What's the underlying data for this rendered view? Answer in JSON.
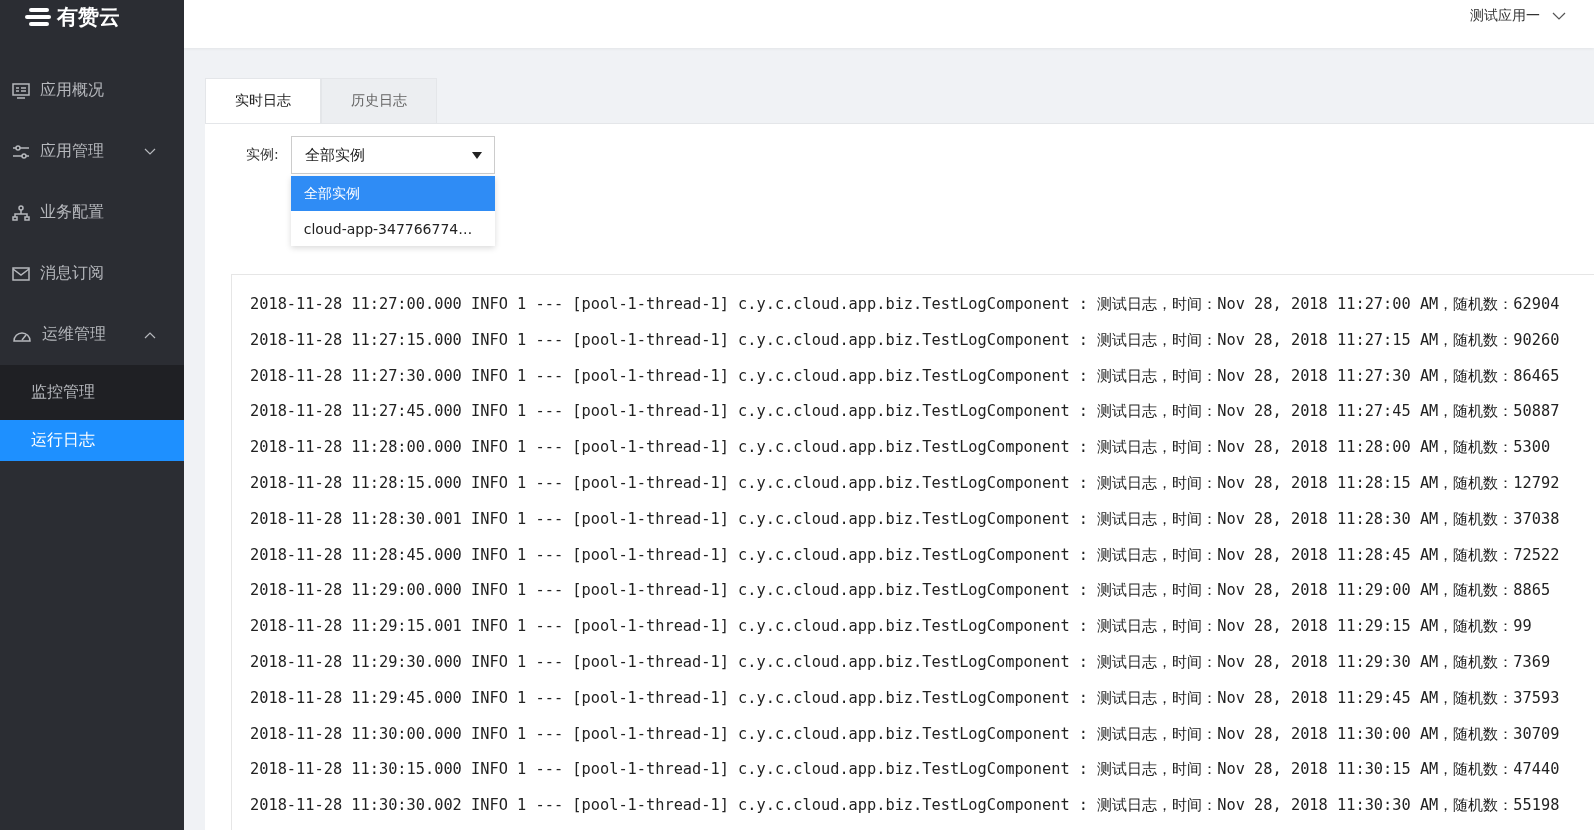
{
  "logo": {
    "text": "有赞云"
  },
  "sidebar": {
    "items": [
      {
        "label": "应用概况",
        "selected": false
      },
      {
        "label": "应用管理",
        "selected": false,
        "expanded": false
      },
      {
        "label": "业务配置",
        "selected": false
      },
      {
        "label": "消息订阅",
        "selected": false
      },
      {
        "label": "运维管理",
        "selected": false,
        "expanded": true,
        "children": [
          {
            "label": "监控管理",
            "selected": false
          },
          {
            "label": "运行日志",
            "selected": true
          }
        ]
      }
    ]
  },
  "header": {
    "app_menu": "测试应用一"
  },
  "tabs": [
    {
      "label": "实时日志",
      "selected": true
    },
    {
      "label": "历史日志",
      "selected": false
    }
  ],
  "instance_filter": {
    "label": "实例:",
    "value": "全部实例",
    "options": [
      {
        "label": "全部实例",
        "selected": true
      },
      {
        "label": "cloud-app-347766774…",
        "selected": false
      }
    ]
  },
  "log_lines": [
    "2018-11-28 11:27:00.000 INFO 1 --- [pool-1-thread-1] c.y.c.cloud.app.biz.TestLogComponent : 测试日志，时间：Nov 28, 2018 11:27:00 AM，随机数：62904",
    "2018-11-28 11:27:15.000 INFO 1 --- [pool-1-thread-1] c.y.c.cloud.app.biz.TestLogComponent : 测试日志，时间：Nov 28, 2018 11:27:15 AM，随机数：90260",
    "2018-11-28 11:27:30.000 INFO 1 --- [pool-1-thread-1] c.y.c.cloud.app.biz.TestLogComponent : 测试日志，时间：Nov 28, 2018 11:27:30 AM，随机数：86465",
    "2018-11-28 11:27:45.000 INFO 1 --- [pool-1-thread-1] c.y.c.cloud.app.biz.TestLogComponent : 测试日志，时间：Nov 28, 2018 11:27:45 AM，随机数：50887",
    "2018-11-28 11:28:00.000 INFO 1 --- [pool-1-thread-1] c.y.c.cloud.app.biz.TestLogComponent : 测试日志，时间：Nov 28, 2018 11:28:00 AM，随机数：5300",
    "2018-11-28 11:28:15.000 INFO 1 --- [pool-1-thread-1] c.y.c.cloud.app.biz.TestLogComponent : 测试日志，时间：Nov 28, 2018 11:28:15 AM，随机数：12792",
    "2018-11-28 11:28:30.001 INFO 1 --- [pool-1-thread-1] c.y.c.cloud.app.biz.TestLogComponent : 测试日志，时间：Nov 28, 2018 11:28:30 AM，随机数：37038",
    "2018-11-28 11:28:45.000 INFO 1 --- [pool-1-thread-1] c.y.c.cloud.app.biz.TestLogComponent : 测试日志，时间：Nov 28, 2018 11:28:45 AM，随机数：72522",
    "2018-11-28 11:29:00.000 INFO 1 --- [pool-1-thread-1] c.y.c.cloud.app.biz.TestLogComponent : 测试日志，时间：Nov 28, 2018 11:29:00 AM，随机数：8865",
    "2018-11-28 11:29:15.001 INFO 1 --- [pool-1-thread-1] c.y.c.cloud.app.biz.TestLogComponent : 测试日志，时间：Nov 28, 2018 11:29:15 AM，随机数：99",
    "2018-11-28 11:29:30.000 INFO 1 --- [pool-1-thread-1] c.y.c.cloud.app.biz.TestLogComponent : 测试日志，时间：Nov 28, 2018 11:29:30 AM，随机数：7369",
    "2018-11-28 11:29:45.000 INFO 1 --- [pool-1-thread-1] c.y.c.cloud.app.biz.TestLogComponent : 测试日志，时间：Nov 28, 2018 11:29:45 AM，随机数：37593",
    "2018-11-28 11:30:00.000 INFO 1 --- [pool-1-thread-1] c.y.c.cloud.app.biz.TestLogComponent : 测试日志，时间：Nov 28, 2018 11:30:00 AM，随机数：30709",
    "2018-11-28 11:30:15.000 INFO 1 --- [pool-1-thread-1] c.y.c.cloud.app.biz.TestLogComponent : 测试日志，时间：Nov 28, 2018 11:30:15 AM，随机数：47440",
    "2018-11-28 11:30:30.002 INFO 1 --- [pool-1-thread-1] c.y.c.cloud.app.biz.TestLogComponent : 测试日志，时间：Nov 28, 2018 11:30:30 AM，随机数：55198"
  ]
}
